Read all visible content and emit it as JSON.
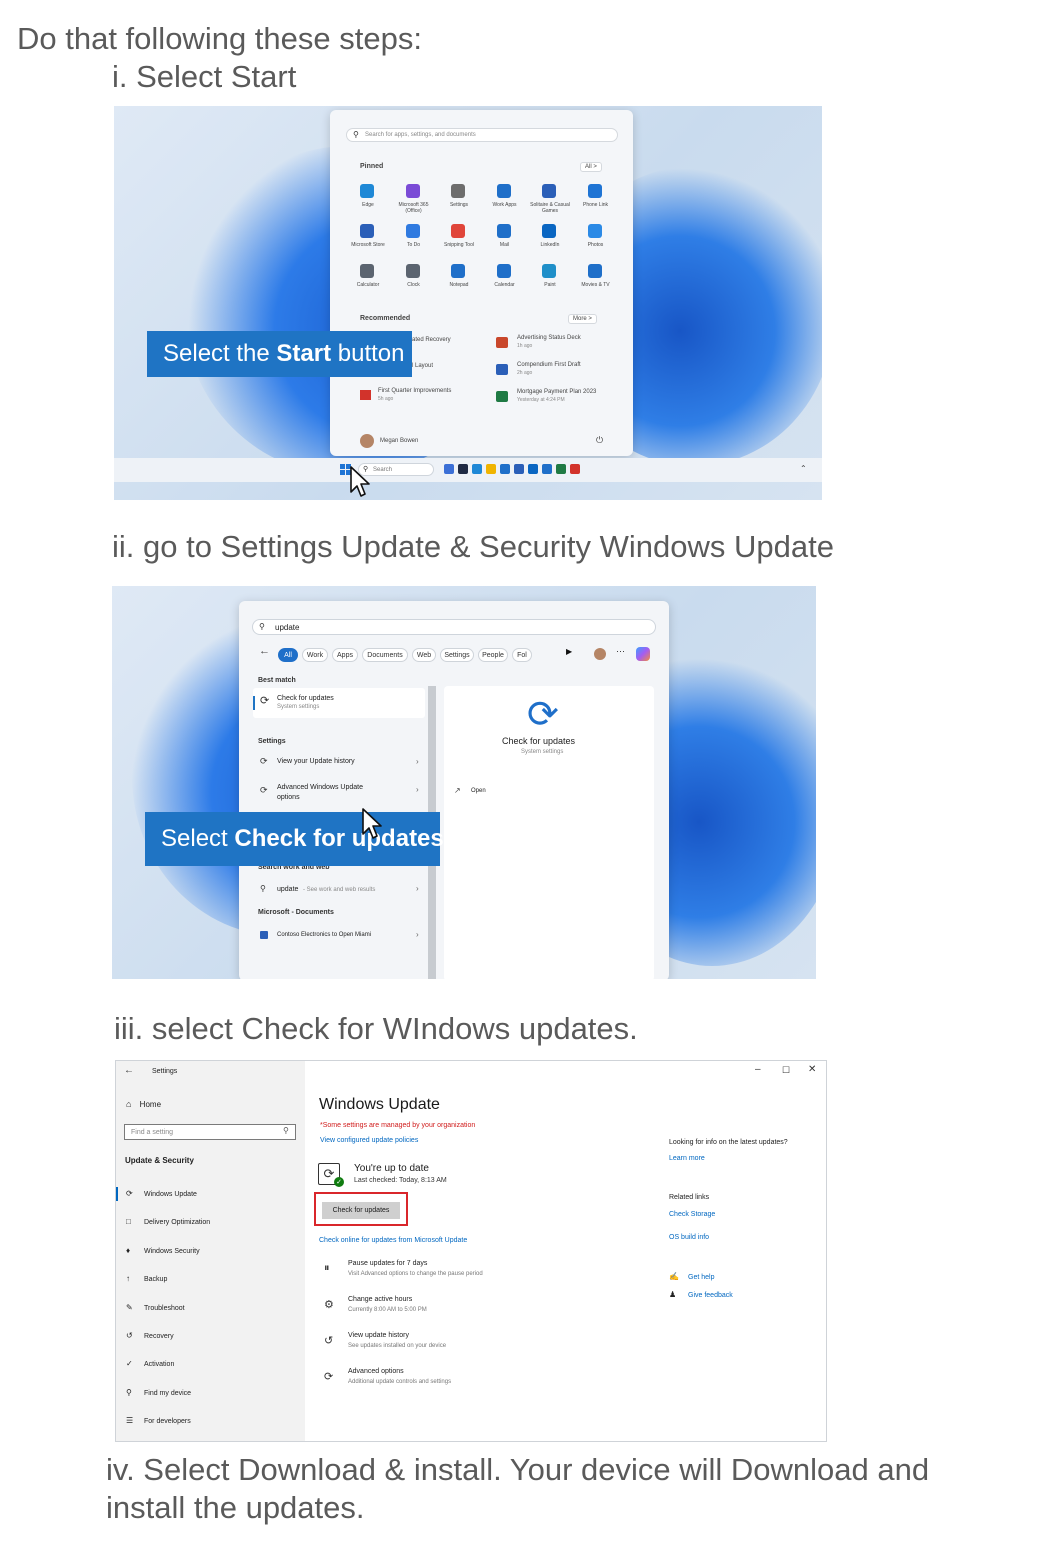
{
  "intro": "Do that following these steps:",
  "steps": [
    {
      "label": "i. Select Start"
    },
    {
      "label": "ii. go to Settings Update & Security Windows Update"
    },
    {
      "label": "iii. select Check for WIndows updates."
    },
    {
      "label_line1": "iv. Select Download & install. Your device will Download and",
      "label_line2": "install the updates."
    }
  ],
  "shot1": {
    "search_placeholder": "Search for apps, settings, and documents",
    "pinned_label": "Pinned",
    "all_button": "All  >",
    "apps": [
      "Edge",
      "Microsoft 365 (Office)",
      "Settings",
      "Work Apps",
      "Solitaire & Casual Games",
      "Phone Link",
      "Microsoft Store",
      "To Do",
      "Snipping Tool",
      "Mail",
      "LinkedIn",
      "Photos",
      "Calculator",
      "Clock",
      "Notepad",
      "Calendar",
      "Paint",
      "Movies & TV"
    ],
    "recommended_label": "Recommended",
    "more_button": "More  >",
    "rec_left": [
      {
        "name": "ated Recovery",
        "time": ""
      },
      {
        "name": "l Layout",
        "time": ""
      },
      {
        "name": "First Quarter Improvements",
        "time": "5h ago"
      }
    ],
    "rec_right": [
      {
        "name": "Advertising Status Deck",
        "time": "1h ago"
      },
      {
        "name": "Compendium First Draft",
        "time": "2h ago"
      },
      {
        "name": "Mortgage Payment Plan 2023",
        "time": "Yesterday at 4:24 PM"
      }
    ],
    "user_name": "Megan Bowen",
    "taskbar_search": "Search",
    "callout_pre": "Select the ",
    "callout_bold": "Start",
    "callout_post": " button",
    "colors": {
      "accent": "#1f74c4",
      "tile_blue": "#1f6fc9"
    }
  },
  "shot2": {
    "search_value": "update",
    "chips": [
      "All",
      "Work",
      "Apps",
      "Documents",
      "Web",
      "Settings",
      "People",
      "Fol"
    ],
    "best_match_label": "Best match",
    "best_title": "Check for updates",
    "best_sub": "System settings",
    "settings_label": "Settings",
    "settings_items": [
      "View your Update history",
      "Advanced Windows Update options"
    ],
    "search_web_label": "Search work and web",
    "web_item": "update",
    "web_item_sub": "- See work and web results",
    "docs_label": "Microsoft - Documents",
    "doc_item": "Contoso Electronics to Open Miami",
    "preview_title": "Check for updates",
    "preview_sub": "System settings",
    "open_label": "Open",
    "callout_pre": "Select ",
    "callout_bold": "Check for updates"
  },
  "shot3": {
    "window_title": "Settings",
    "home": "Home",
    "find_placeholder": "Find a setting",
    "section": "Update & Security",
    "nav": [
      "Windows Update",
      "Delivery Optimization",
      "Windows Security",
      "Backup",
      "Troubleshoot",
      "Recovery",
      "Activation",
      "Find my device",
      "For developers"
    ],
    "page_title": "Windows Update",
    "managed_notice": "*Some settings are managed by your organization",
    "view_policies": "View configured update policies",
    "status_title": "You're up to date",
    "status_sub": "Last checked: Today, 8:13 AM",
    "check_button": "Check for updates",
    "check_online": "Check online for updates from Microsoft Update",
    "options": [
      {
        "title": "Pause updates for 7 days",
        "sub": "Visit Advanced options to change the pause period"
      },
      {
        "title": "Change active hours",
        "sub": "Currently 8:00 AM to 5:00 PM"
      },
      {
        "title": "View update history",
        "sub": "See updates installed on your device"
      },
      {
        "title": "Advanced options",
        "sub": "Additional update controls and settings"
      }
    ],
    "right_q": "Looking for info on the latest updates?",
    "learn_more": "Learn more",
    "related_label": "Related links",
    "check_storage": "Check Storage",
    "os_build": "OS build info",
    "get_help": "Get help",
    "give_feedback": "Give feedback",
    "colors": {
      "highlight": "#d9262b",
      "managed": "#d01c1c",
      "link": "#0067c0"
    }
  }
}
